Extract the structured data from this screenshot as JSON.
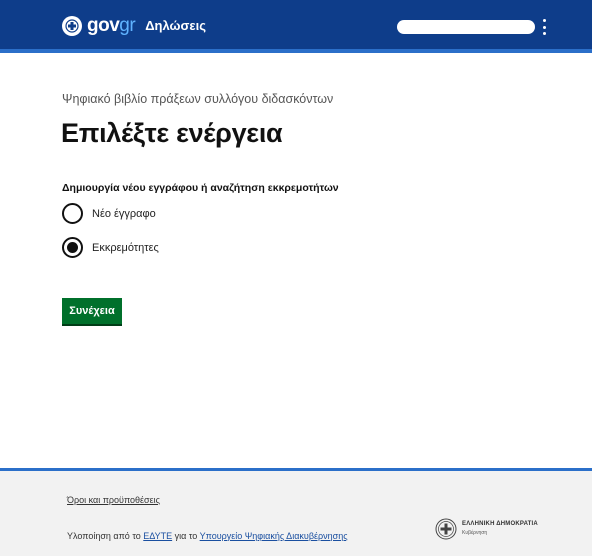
{
  "header": {
    "logo_primary": "gov",
    "logo_secondary": "gr",
    "service_name": "Δηλώσεις",
    "colors": {
      "bar": "#0e3d8a",
      "accent_line": "#2b6fc9"
    },
    "icons": {
      "logo": "greek-emblem-icon",
      "menu": "kebab-menu-icon"
    }
  },
  "main": {
    "caption": "Ψηφιακό βιβλίο πράξεων συλλόγου διδασκόντων",
    "title": "Επιλέξτε ενέργεια",
    "question": "Δημιουργία νέου εγγράφου ή αναζήτηση εκκρεμοτήτων",
    "options": [
      {
        "label": "Νέο έγγραφο",
        "selected": false
      },
      {
        "label": "Εκκρεμότητες",
        "selected": true
      }
    ],
    "continue_label": "Συνέχεια",
    "colors": {
      "button": "#00702b"
    }
  },
  "footer": {
    "terms_link": "Όροι και προϋποθέσεις",
    "impl_prefix": "Υλοποίηση από το",
    "impl_org": "ΕΔΥΤΕ",
    "impl_middle": "για το",
    "impl_ministry": "Υπουργείο Ψηφιακής Διακυβέρνησης",
    "gov_title": "ΕΛΛΗΝΙΚΗ ΔΗΜΟΚΡΑΤΙΑ",
    "gov_subtitle": "Κυβέρνηση",
    "icons": {
      "emblem": "hellenic-republic-emblem-icon"
    }
  }
}
